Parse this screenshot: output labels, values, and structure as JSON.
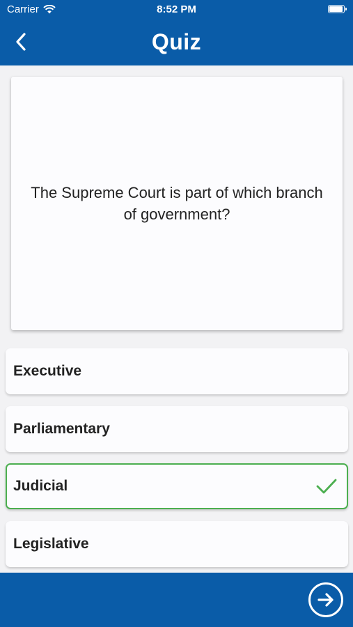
{
  "status_bar": {
    "carrier": "Carrier",
    "time": "8:52 PM",
    "battery_level": 0.95
  },
  "header": {
    "title": "Quiz",
    "back_icon": "chevron-left-icon"
  },
  "question": {
    "text": "The Supreme Court is part of which branch of government?"
  },
  "answers": [
    {
      "label": "Executive",
      "state": "default"
    },
    {
      "label": "Parliamentary",
      "state": "default"
    },
    {
      "label": "Judicial",
      "state": "correct"
    },
    {
      "label": "Legislative",
      "state": "default"
    }
  ],
  "footer": {
    "next_icon": "arrow-right-circle-icon"
  },
  "colors": {
    "primary": "#0a5ca8",
    "correct": "#4caf50",
    "background": "#f2f2f4",
    "card": "#fcfcfe"
  }
}
